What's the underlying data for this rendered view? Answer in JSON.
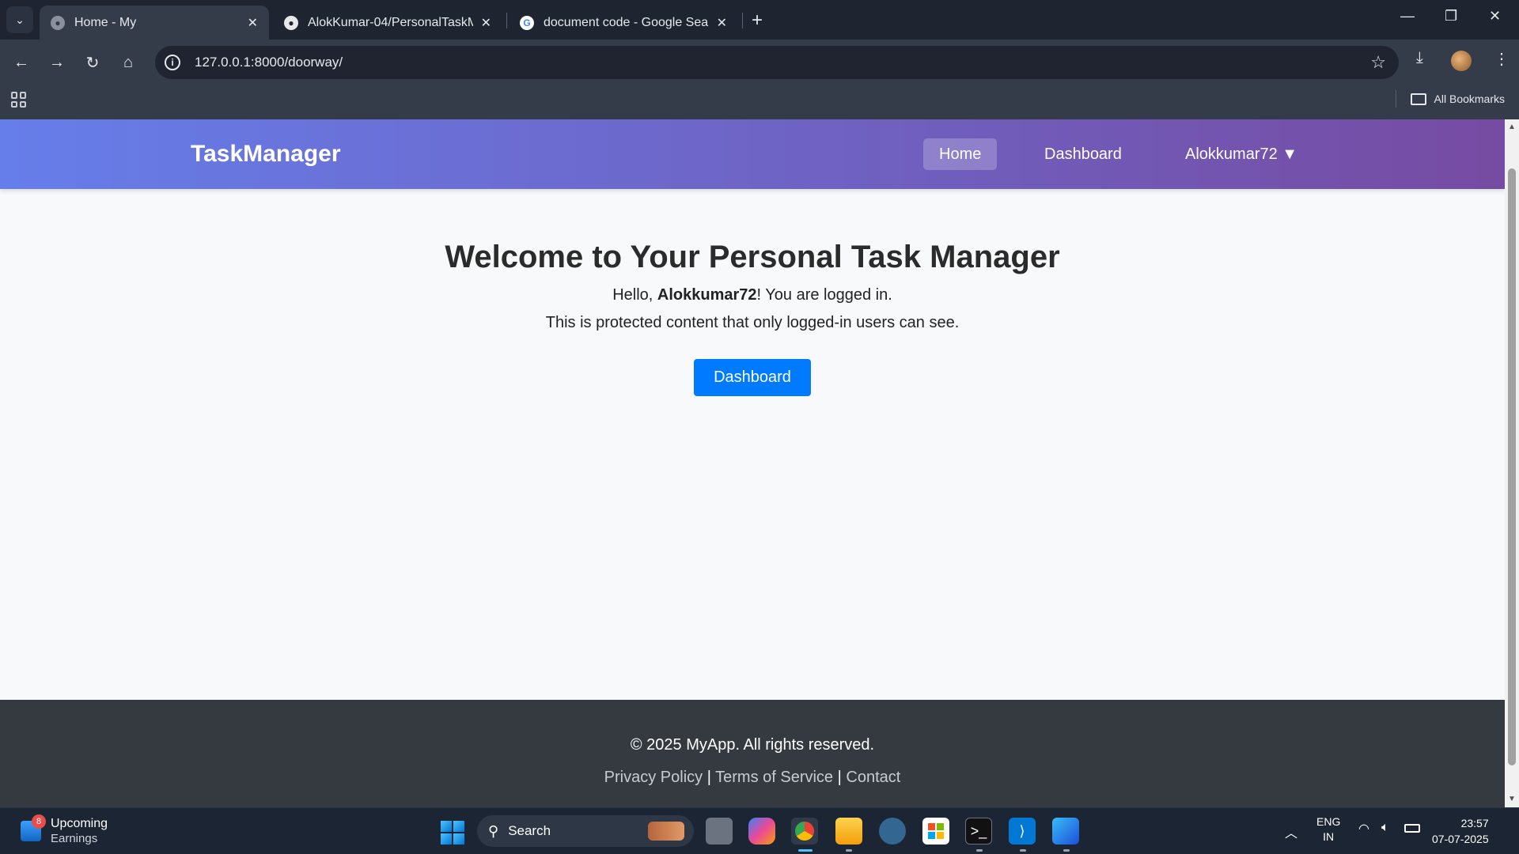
{
  "browser": {
    "tabs": [
      {
        "title": "Home - My",
        "active": true,
        "favicon": "globe-icon"
      },
      {
        "title": "AlokKumar-04/PersonalTaskMa",
        "active": false,
        "favicon": "github-icon"
      },
      {
        "title": "document code - Google Searc",
        "active": false,
        "favicon": "google-icon"
      }
    ],
    "url": "127.0.0.1:8000/doorway/",
    "bookmarks_label": "All Bookmarks"
  },
  "site": {
    "brand": "TaskManager",
    "nav": {
      "home": "Home",
      "dashboard": "Dashboard",
      "user": "Alokkumar72 ▼"
    },
    "heading": "Welcome to Your Personal Task Manager",
    "hello_prefix": "Hello, ",
    "username": "Alokkumar72",
    "hello_suffix": "! You are logged in.",
    "protected_text": "This is protected content that only logged-in users can see.",
    "cta_label": "Dashboard",
    "footer": {
      "copyright": "© 2025 MyApp. All rights reserved.",
      "links": [
        "Privacy Policy",
        "Terms of Service",
        "Contact"
      ],
      "separator": "|"
    },
    "colors": {
      "nav_gradient_start": "#667eea",
      "nav_gradient_end": "#764ba2",
      "primary_button": "#007bff",
      "footer_bg": "#343a40"
    }
  },
  "taskbar": {
    "widget_badge": "8",
    "widget_title": "Upcoming",
    "widget_subtitle": "Earnings",
    "search_label": "Search",
    "lang_top": "ENG",
    "lang_bottom": "IN",
    "time": "23:57",
    "date": "07-07-2025"
  }
}
